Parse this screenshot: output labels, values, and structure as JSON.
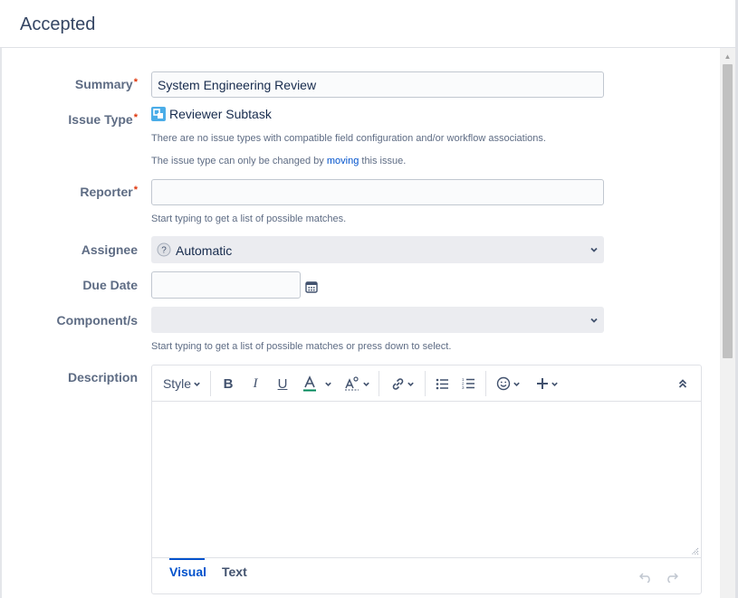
{
  "dialog": {
    "title": "Accepted"
  },
  "fields": {
    "summary": {
      "label": "Summary",
      "required_mark": "*",
      "value": "System Engineering Review"
    },
    "issue_type": {
      "label": "Issue Type",
      "required_mark": "*",
      "value": "Reviewer Subtask",
      "help_1": "There are no issue types with compatible field configuration and/or workflow associations.",
      "help_2_prefix": "The issue type can only be changed by ",
      "help_2_link": "moving",
      "help_2_suffix": " this issue."
    },
    "reporter": {
      "label": "Reporter",
      "required_mark": "*",
      "value": "",
      "help": "Start typing to get a list of possible matches."
    },
    "assignee": {
      "label": "Assignee",
      "value": "Automatic"
    },
    "due_date": {
      "label": "Due Date",
      "value": ""
    },
    "components": {
      "label": "Component/s",
      "value": "",
      "help": "Start typing to get a list of possible matches or press down to select."
    },
    "description": {
      "label": "Description",
      "toolbar": {
        "style_label": "Style"
      },
      "tabs": {
        "visual": "Visual",
        "text": "Text"
      }
    }
  },
  "colors": {
    "accent": "#0052cc",
    "required": "#de350b",
    "label": "#5e6c84"
  }
}
